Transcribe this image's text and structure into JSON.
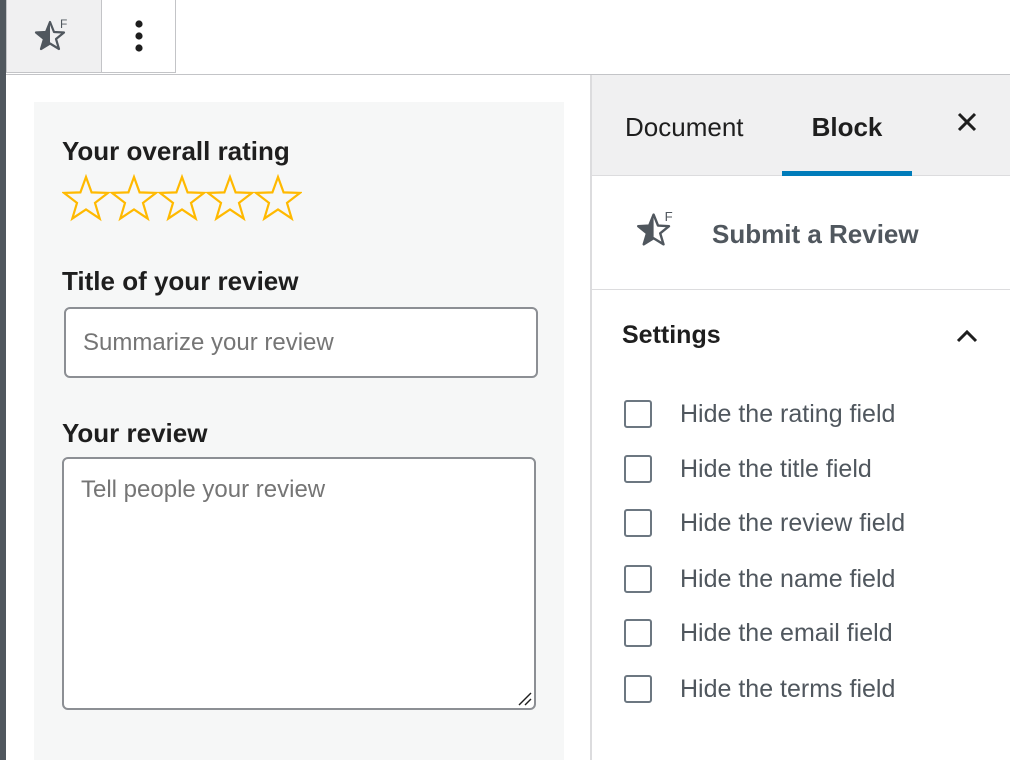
{
  "toolbar": {
    "block_icon": "star-f-icon",
    "more_icon": "vertical-ellipsis-icon"
  },
  "editor": {
    "rating_label": "Your overall rating",
    "rating": {
      "value": 0,
      "max": 5,
      "star_color": "#ffb900"
    },
    "title_label": "Title of your review",
    "title_placeholder": "Summarize your review",
    "review_label": "Your review",
    "review_placeholder": "Tell people your review"
  },
  "sidebar": {
    "tabs": [
      {
        "label": "Document",
        "active": false
      },
      {
        "label": "Block",
        "active": true
      }
    ],
    "close_icon": "close-icon",
    "block_name": "Submit a Review",
    "settings_title": "Settings",
    "options": [
      {
        "label": "Hide the rating field",
        "checked": false
      },
      {
        "label": "Hide the title field",
        "checked": false
      },
      {
        "label": "Hide the review field",
        "checked": false
      },
      {
        "label": "Hide the name field",
        "checked": false
      },
      {
        "label": "Hide the email field",
        "checked": false
      },
      {
        "label": "Hide the terms field",
        "checked": false
      }
    ],
    "accent_color": "#007cba"
  }
}
